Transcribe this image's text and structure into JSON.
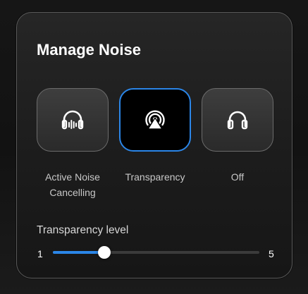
{
  "panel": {
    "title": "Manage Noise"
  },
  "modes": [
    {
      "label": "Active Noise Cancelling",
      "icon": "headphones-anc-icon",
      "selected": false
    },
    {
      "label": "Transparency",
      "icon": "transparency-icon",
      "selected": true
    },
    {
      "label": "Off",
      "icon": "headphones-icon",
      "selected": false
    }
  ],
  "transparency": {
    "label": "Transparency level",
    "min": "1",
    "max": "5",
    "value": 2
  },
  "colors": {
    "accent": "#2b86e8",
    "selected_background": "#000000"
  }
}
